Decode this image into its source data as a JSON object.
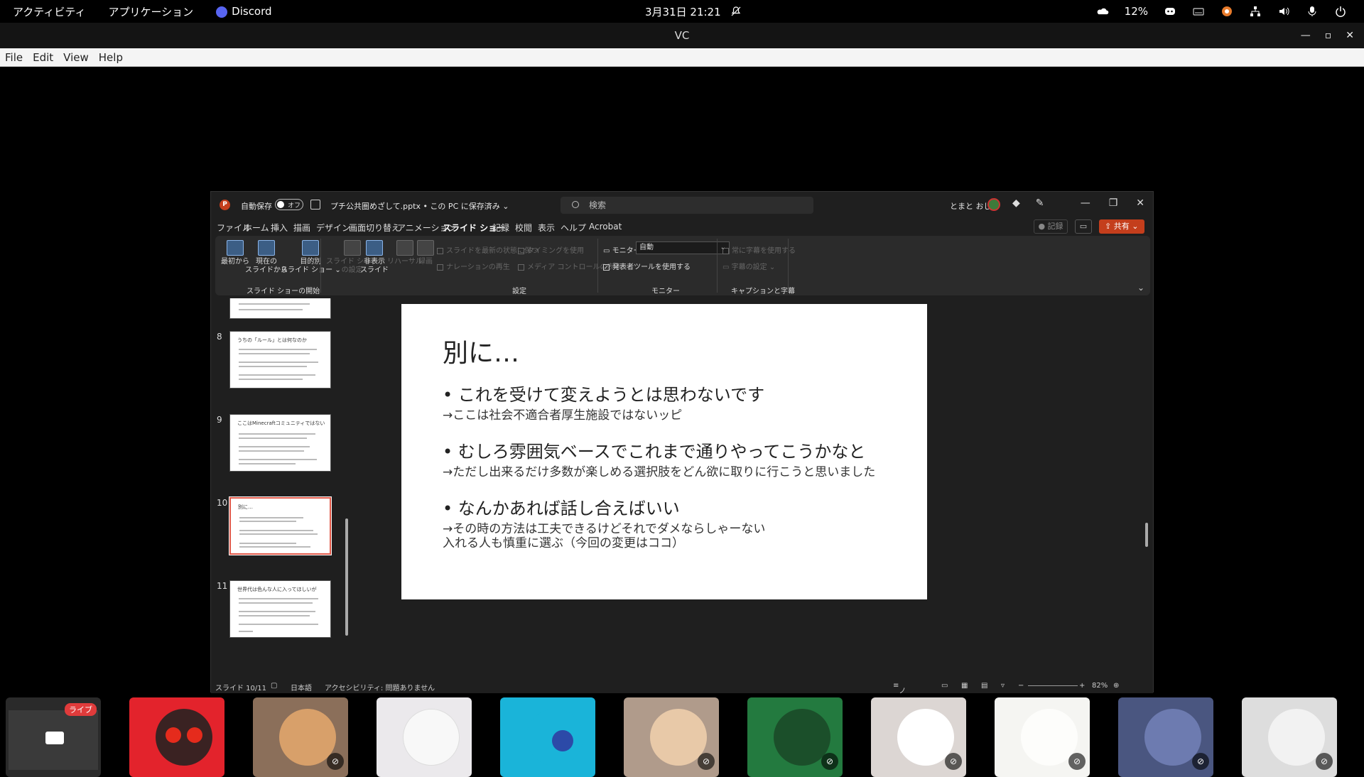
{
  "topbar": {
    "activities": "アクティビティ",
    "applications": "アプリケーション",
    "app_name": "Discord",
    "clock": "3月31日  21:21",
    "battery": "12%"
  },
  "vc_window": {
    "title": "VC",
    "menu": [
      "File",
      "Edit",
      "View",
      "Help"
    ]
  },
  "ppt": {
    "autosave_label": "自動保存",
    "autosave_state": "オフ",
    "filename": "プチ公共圏めざして.pptx • この PC に保存済み ⌄",
    "search_placeholder": "検索",
    "username": "とまと おじ",
    "tabs": [
      "ファイル",
      "ホーム",
      "挿入",
      "描画",
      "デザイン",
      "画面切り替え",
      "アニメーション",
      "スライド ショー",
      "記録",
      "校閲",
      "表示",
      "ヘルプ",
      "Acrobat"
    ],
    "active_tab": "スライド ショー",
    "record_btn": "記録",
    "share_btn": "共有",
    "ribbon": {
      "from_start": "最初から",
      "from_current_1": "現在の",
      "from_current_2": "スライドから",
      "custom_1": "目的別",
      "custom_2": "スライド ショー ⌄",
      "group_start": "スライド ショーの開始",
      "setup_1": "スライド ショー",
      "setup_2": "の設定",
      "hide_1": "非表示",
      "hide_2": "スライド",
      "rehearse": "リハーサル",
      "record": "録画",
      "chk_keep_fresh": "スライドを最新の状態に保つ",
      "chk_narration": "ナレーションの再生",
      "chk_timing": "タイミングを使用",
      "chk_media": "メディア コントロールの表示",
      "group_setup": "設定",
      "monitor_label": "モニター:",
      "monitor_value": "自動",
      "chk_presenter": "発表者ツールを使用する",
      "group_monitor": "モニター",
      "chk_subtitles": "常に字幕を使用する",
      "subtitle_settings": "字幕の設定 ⌄",
      "group_captions": "キャプションと字幕"
    },
    "thumbnails": [
      {
        "num": "",
        "title": ""
      },
      {
        "num": "8",
        "title": "うちの「ルール」とは何なのか"
      },
      {
        "num": "9",
        "title": "ここはMinecraftコミュニティではない"
      },
      {
        "num": "10",
        "title": "別に…"
      },
      {
        "num": "11",
        "title": "世界代は色んな人に入ってほしいが"
      }
    ],
    "slide": {
      "title": "別に…",
      "bullet1": "• これを受けて変えようとは思わないです",
      "sub1": "→ここは社会不適合者厚生施設ではないッピ",
      "bullet2": "• むしろ雰囲気ベースでこれまで通りやってこうかなと",
      "sub2": "→ただし出来るだけ多数が楽しめる選択肢をどん欲に取りに行こうと思いました",
      "bullet3": "• なんかあれば話し合えばいい",
      "sub3a": "→その時の方法は工夫できるけどそれでダメならしゃーない",
      "sub3b": "入れる人も慎重に選ぶ（今回の変更はココ）"
    },
    "status": {
      "slide_pos": "スライド 10/11",
      "language": "日本語",
      "accessibility": "アクセシビリティ: 問題ありません",
      "notes": "ノート",
      "zoom": "82%"
    }
  },
  "participants": {
    "live_label": "ライブ"
  }
}
